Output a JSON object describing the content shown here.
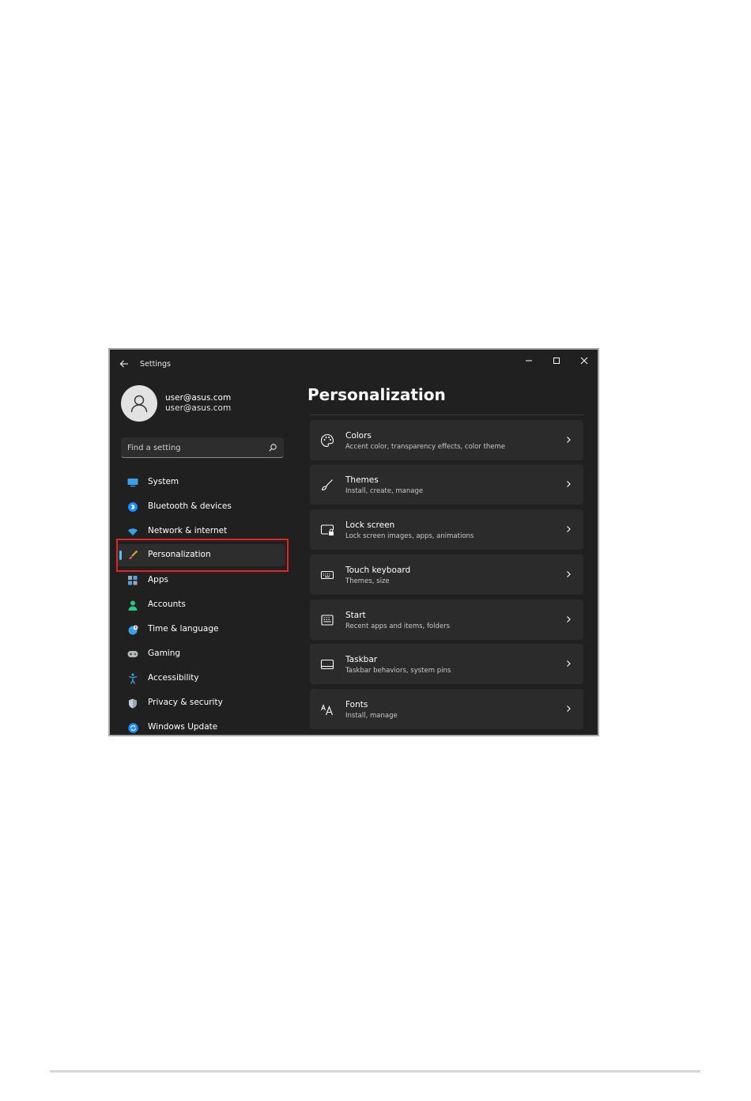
{
  "window": {
    "title": "Settings"
  },
  "user": {
    "name": "user@asus.com",
    "email": "user@asus.com"
  },
  "search": {
    "placeholder": "Find a setting"
  },
  "sidebar": {
    "items": [
      {
        "label": "System",
        "icon": "monitor-icon"
      },
      {
        "label": "Bluetooth & devices",
        "icon": "bluetooth-icon"
      },
      {
        "label": "Network & internet",
        "icon": "wifi-icon"
      },
      {
        "label": "Personalization",
        "icon": "brush-icon",
        "selected": true
      },
      {
        "label": "Apps",
        "icon": "apps-icon"
      },
      {
        "label": "Accounts",
        "icon": "person-icon"
      },
      {
        "label": "Time & language",
        "icon": "globe-clock-icon"
      },
      {
        "label": "Gaming",
        "icon": "gamepad-icon"
      },
      {
        "label": "Accessibility",
        "icon": "accessibility-icon"
      },
      {
        "label": "Privacy & security",
        "icon": "shield-icon"
      },
      {
        "label": "Windows Update",
        "icon": "refresh-icon"
      }
    ]
  },
  "main": {
    "title": "Personalization",
    "cards": [
      {
        "title": "Colors",
        "subtitle": "Accent color, transparency effects, color theme",
        "icon": "palette-icon"
      },
      {
        "title": "Themes",
        "subtitle": "Install, create, manage",
        "icon": "brush-icon"
      },
      {
        "title": "Lock screen",
        "subtitle": "Lock screen images, apps, animations",
        "icon": "lock-screen-icon"
      },
      {
        "title": "Touch keyboard",
        "subtitle": "Themes, size",
        "icon": "keyboard-icon"
      },
      {
        "title": "Start",
        "subtitle": "Recent apps and items, folders",
        "icon": "start-icon"
      },
      {
        "title": "Taskbar",
        "subtitle": "Taskbar behaviors, system pins",
        "icon": "taskbar-icon"
      },
      {
        "title": "Fonts",
        "subtitle": "Install, manage",
        "icon": "fonts-icon"
      }
    ]
  },
  "colors": {
    "window_bg": "#202020",
    "card_bg": "#2b2b2b",
    "accent": "#4cc2ff",
    "highlight": "#e2232a"
  }
}
